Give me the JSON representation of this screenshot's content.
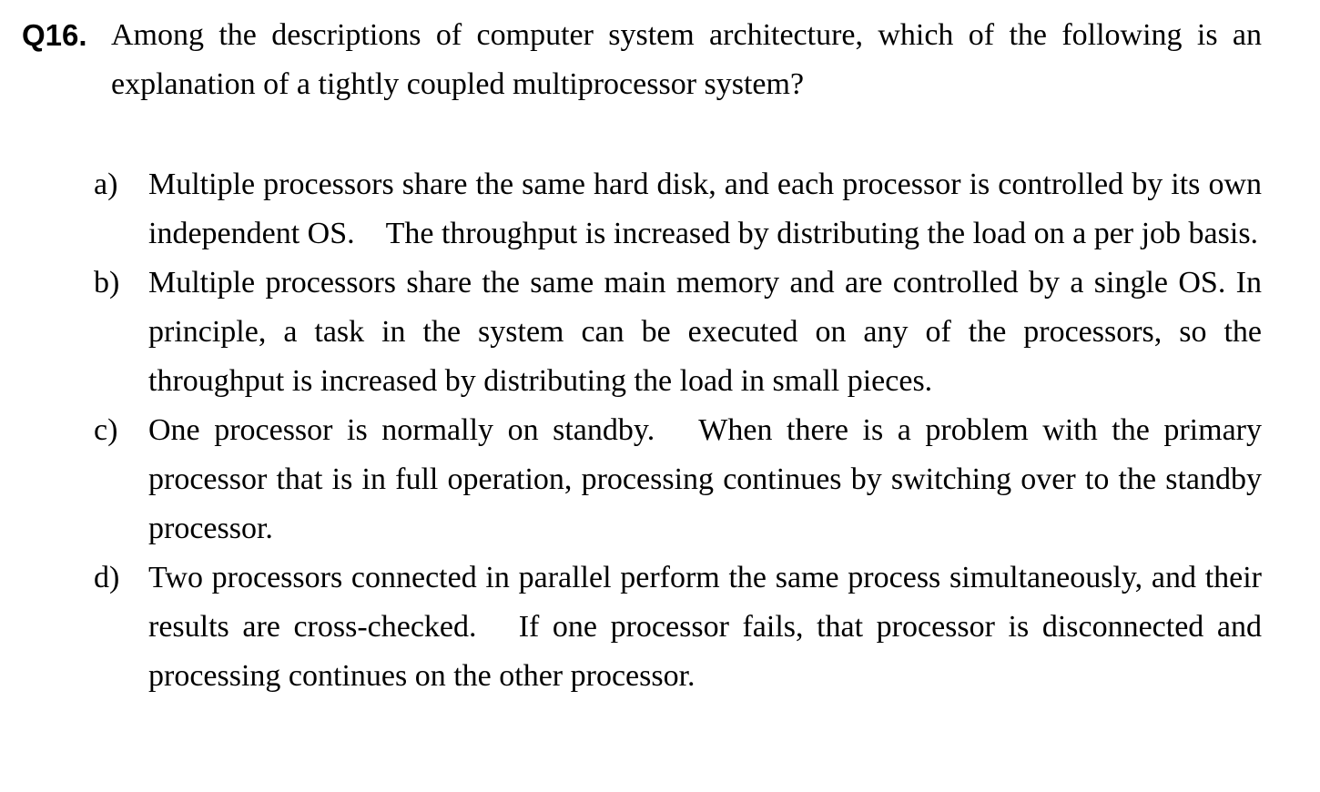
{
  "question": {
    "number": "Q16.",
    "text": "Among the descriptions of computer system architecture, which of the following is an explanation of a tightly coupled multiprocessor system?"
  },
  "options": [
    {
      "letter": "a)",
      "text": "Multiple processors share the same hard disk, and each processor is controlled by its own independent OS.　The throughput is increased by distributing the load on a per job basis."
    },
    {
      "letter": "b)",
      "text": "Multiple processors share the same main memory and are controlled by a single OS. In principle, a task in the system can be executed on any of the processors, so the throughput is increased by distributing the load in small pieces."
    },
    {
      "letter": "c)",
      "text": "One processor is normally on standby.　When there is a problem with the primary processor that is in full operation, processing continues by switching over to the standby processor."
    },
    {
      "letter": "d)",
      "text": "Two processors connected in parallel perform the same process simultaneously, and their results are cross-checked.　If one processor fails, that processor is disconnected and processing continues on the other processor."
    }
  ]
}
